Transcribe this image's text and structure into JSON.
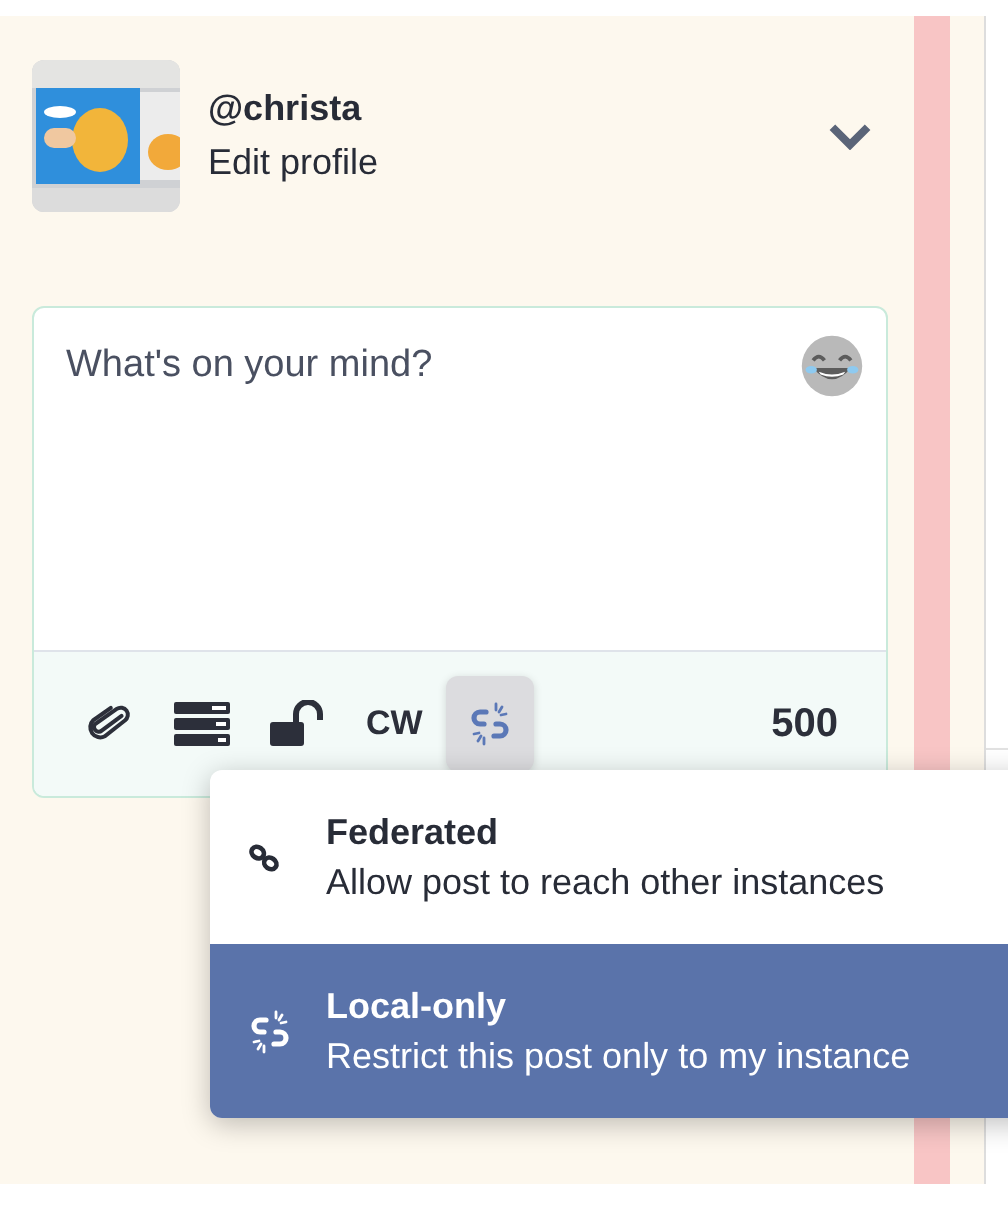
{
  "account": {
    "handle": "@christa",
    "edit_link": "Edit profile"
  },
  "composer": {
    "placeholder": "What's on your mind?",
    "toolbar": [
      {
        "kind": "attach",
        "active": false
      },
      {
        "kind": "poll",
        "active": false
      },
      {
        "kind": "visibility",
        "active": false
      },
      {
        "kind": "cw",
        "label": "CW",
        "active": false
      },
      {
        "kind": "local",
        "active": true
      }
    ],
    "char_count": "500"
  },
  "menu": {
    "items": [
      {
        "kind": "federated",
        "title": "Federated",
        "description": "Allow post to reach other instances",
        "selected": false
      },
      {
        "kind": "local",
        "title": "Local-only",
        "description": "Restrict this post only to my instance",
        "selected": true
      }
    ]
  }
}
